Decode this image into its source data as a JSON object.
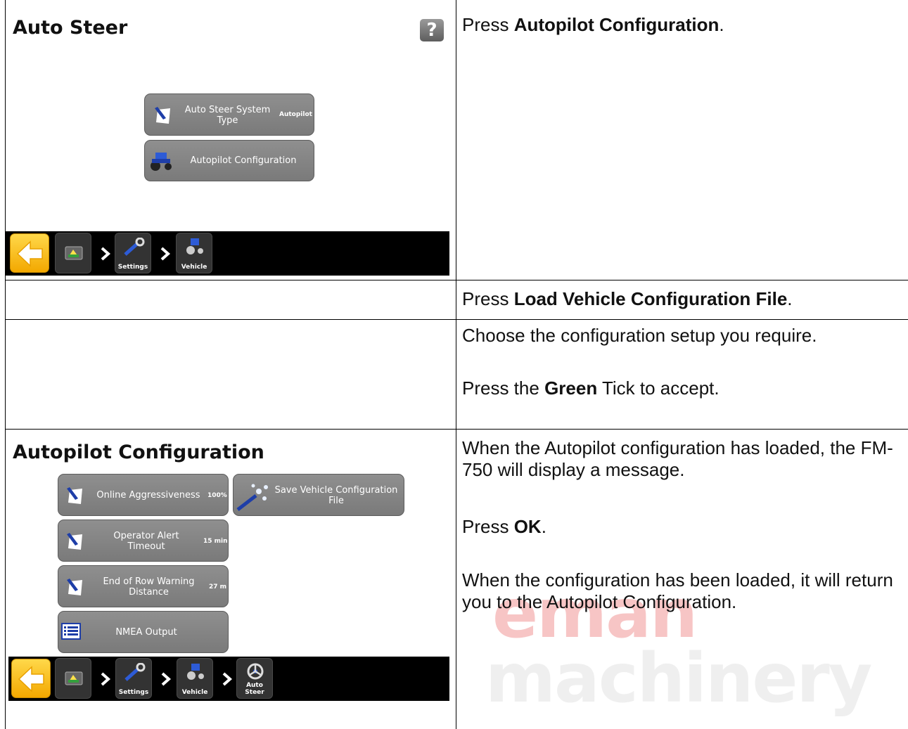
{
  "screen1": {
    "title": "Auto Steer",
    "help_label": "?",
    "buttons": [
      {
        "label_line1": "Auto Steer System",
        "label_line2": "Type",
        "value": "Autopilot",
        "icon": "pencil-paper-icon"
      },
      {
        "label": "Autopilot Configuration",
        "icon": "tractor-icon"
      }
    ],
    "nav": {
      "items": [
        {
          "label": "",
          "icon": "back-arrow-icon"
        },
        {
          "label": "",
          "icon": "console-icon"
        },
        {
          "label": "Settings",
          "icon": "wrench-icon"
        },
        {
          "label": "Vehicle",
          "icon": "tractor-icon"
        }
      ]
    }
  },
  "screen2": {
    "title": "Autopilot Configuration",
    "buttons": [
      {
        "label": "Online Aggressiveness",
        "value": "100%",
        "icon": "pencil-paper-icon"
      },
      {
        "label_line1": "Save Vehicle Configuration",
        "label_line2": "File",
        "icon": "magic-wand-icon"
      },
      {
        "label_line1": "Operator Alert",
        "label_line2": "Timeout",
        "value": "15 min",
        "icon": "pencil-paper-icon"
      },
      {
        "label_line1": "End of Row Warning",
        "label_line2": "Distance",
        "value": "27 m",
        "icon": "pencil-paper-icon"
      },
      {
        "label": "NMEA Output",
        "icon": "list-icon"
      }
    ],
    "nav": {
      "items": [
        {
          "label": "",
          "icon": "back-arrow-icon"
        },
        {
          "label": "",
          "icon": "console-icon"
        },
        {
          "label": "Settings",
          "icon": "wrench-icon"
        },
        {
          "label": "Vehicle",
          "icon": "tractor-icon"
        },
        {
          "label": "Auto Steer",
          "icon": "steering-wheel-icon"
        }
      ]
    }
  },
  "instructions": {
    "row1": {
      "pre": "Press ",
      "bold": "Autopilot Configuration",
      "post": "."
    },
    "row2": {
      "pre": "Press ",
      "bold": "Load Vehicle Configuration File",
      "post": "."
    },
    "row3a": "Choose the configuration setup you require.",
    "row3b": {
      "pre": "Press the ",
      "bold": "Green",
      "post": " Tick to accept."
    },
    "row4a": "When the Autopilot configuration has loaded, the FM-750 will display a message.",
    "row4b": {
      "pre": "Press ",
      "bold": "OK",
      "post": "."
    },
    "row4c": "When the configuration has been loaded, it will return you to the Autopilot Configuration."
  },
  "watermark": {
    "line1": "eman",
    "line2": "machinery"
  },
  "colors": {
    "button_gray": "#858585",
    "nav_back_yellow": "#f7c21f",
    "watermark_red": "#e63232"
  }
}
